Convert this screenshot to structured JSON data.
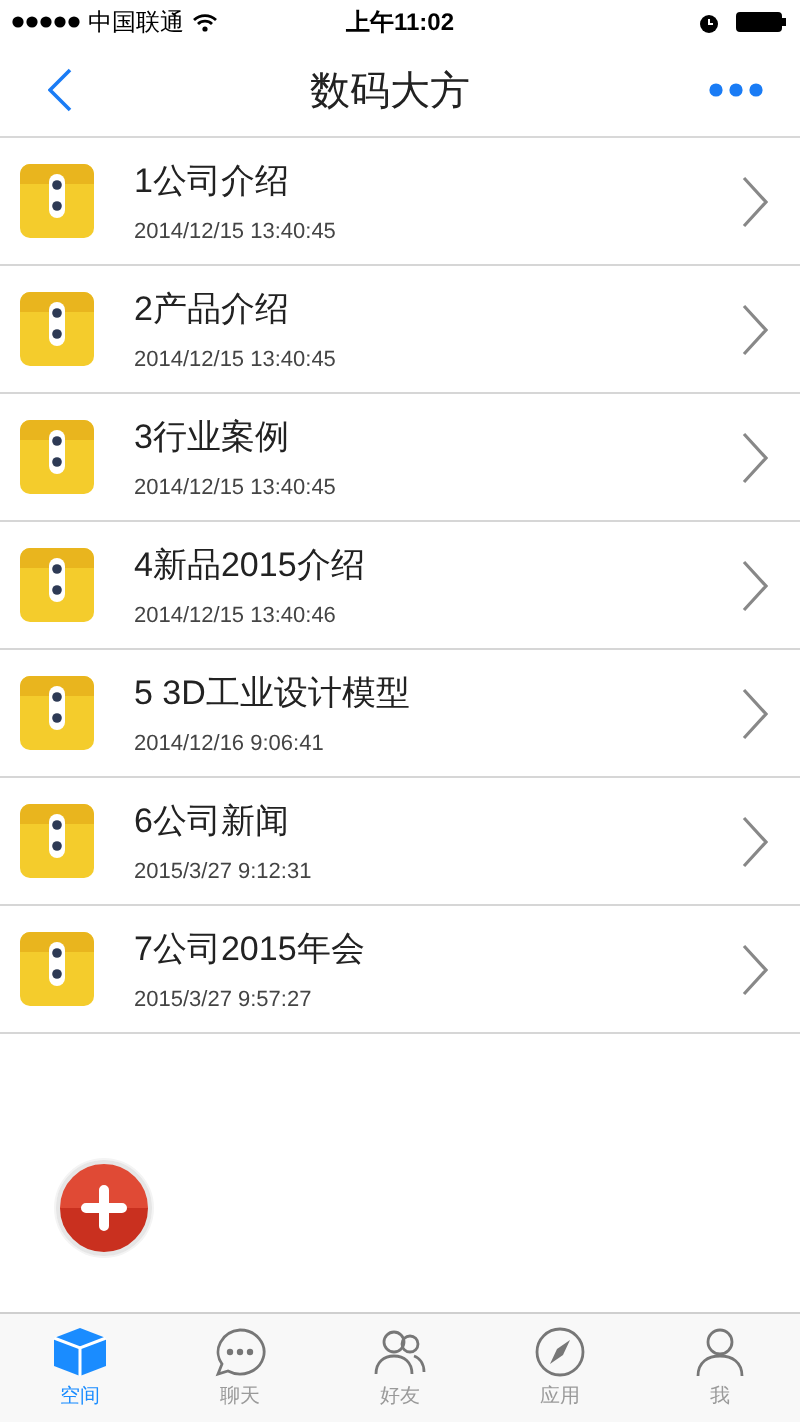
{
  "status_bar": {
    "carrier": "中国联通",
    "time": "上午11:02"
  },
  "nav": {
    "title": "数码大方"
  },
  "items": [
    {
      "title": "1公司介绍",
      "date": "2014/12/15 13:40:45"
    },
    {
      "title": "2产品介绍",
      "date": "2014/12/15 13:40:45"
    },
    {
      "title": "3行业案例",
      "date": "2014/12/15 13:40:45"
    },
    {
      "title": "4新品2015介绍",
      "date": "2014/12/15 13:40:46"
    },
    {
      "title": "5 3D工业设计模型",
      "date": "2014/12/16 9:06:41"
    },
    {
      "title": "6公司新闻",
      "date": "2015/3/27 9:12:31"
    },
    {
      "title": "7公司2015年会",
      "date": "2015/3/27 9:57:27"
    }
  ],
  "tabs": [
    {
      "label": "空间",
      "kind": "box",
      "selected": true
    },
    {
      "label": "聊天",
      "kind": "chat",
      "selected": false
    },
    {
      "label": "好友",
      "kind": "friends",
      "selected": false
    },
    {
      "label": "应用",
      "kind": "compass",
      "selected": false
    },
    {
      "label": "我",
      "kind": "person",
      "selected": false
    }
  ]
}
